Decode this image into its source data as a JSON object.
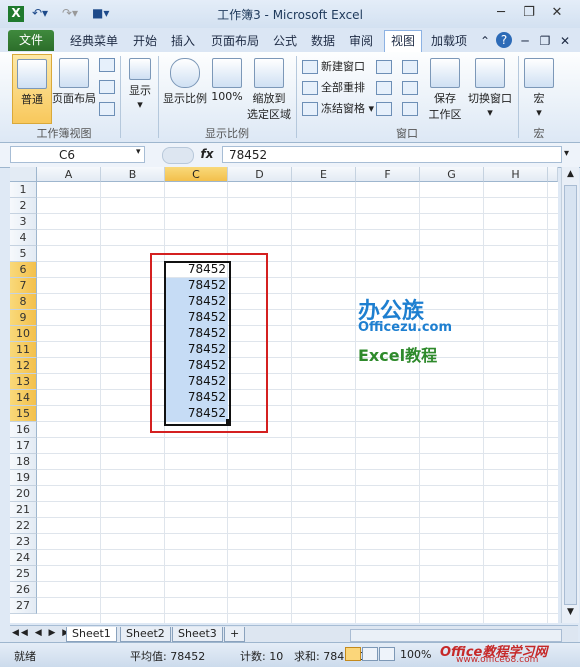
{
  "window": {
    "title": "工作簿3 - Microsoft Excel",
    "qat": [
      "save-icon",
      "undo-icon",
      "redo-icon"
    ]
  },
  "tabs": [
    "文件",
    "经典菜单",
    "开始",
    "插入",
    "页面布局",
    "公式",
    "数据",
    "审阅",
    "视图",
    "加载项"
  ],
  "active_tab": "视图",
  "ribbon": {
    "workbook_views": {
      "normal": "普通",
      "page_layout": "页面布局",
      "group": "工作簿视图"
    },
    "show": {
      "label": "显示"
    },
    "zoom": {
      "zoom": "显示比例",
      "hundred": "100%",
      "zoom_to_sel_1": "缩放到",
      "zoom_to_sel_2": "选定区域",
      "group": "显示比例"
    },
    "window": {
      "new": "新建窗口",
      "arrange": "全部重排",
      "freeze": "冻结窗格",
      "save_ws_1": "保存",
      "save_ws_2": "工作区",
      "switch": "切换窗口",
      "group": "窗口"
    },
    "macros": {
      "label": "宏",
      "group": "宏"
    }
  },
  "formula_bar": {
    "name_box": "C6",
    "fx": "fx",
    "value": "78452"
  },
  "sheet": {
    "columns": [
      "A",
      "B",
      "C",
      "D",
      "E",
      "F",
      "G",
      "H"
    ],
    "selected_column": "C",
    "rows": [
      "1",
      "2",
      "3",
      "4",
      "5",
      "6",
      "7",
      "8",
      "9",
      "10",
      "11",
      "12",
      "13",
      "14",
      "15",
      "16",
      "17",
      "18",
      "19",
      "20",
      "21",
      "22",
      "23",
      "24",
      "25",
      "26",
      "27"
    ],
    "selected_rows": [
      "6",
      "7",
      "8",
      "9",
      "10",
      "11",
      "12",
      "13",
      "14",
      "15"
    ],
    "c_values": [
      "78452",
      "78452",
      "78452",
      "78452",
      "78452",
      "78452",
      "78452",
      "78452",
      "78452",
      "78452"
    ]
  },
  "watermark": {
    "line1": "办公族",
    "line2": "Officezu.com",
    "line3": "Excel教程"
  },
  "sheet_tabs": [
    "Sheet1",
    "Sheet2",
    "Sheet3"
  ],
  "active_sheet": "Sheet1",
  "status_bar": {
    "ready": "就绪",
    "average": "平均值: 78452",
    "count": "计数: 10",
    "sum": "求和: 784520",
    "zoom": "100%",
    "site_watermark": "Office教程学习网",
    "site_url": "www.office68.com"
  },
  "colors": {
    "selection_fill": "#c6dcf5",
    "active_header": "#f3c04c",
    "highlight_box": "#d42020",
    "file_tab": "#2c6e2a"
  }
}
